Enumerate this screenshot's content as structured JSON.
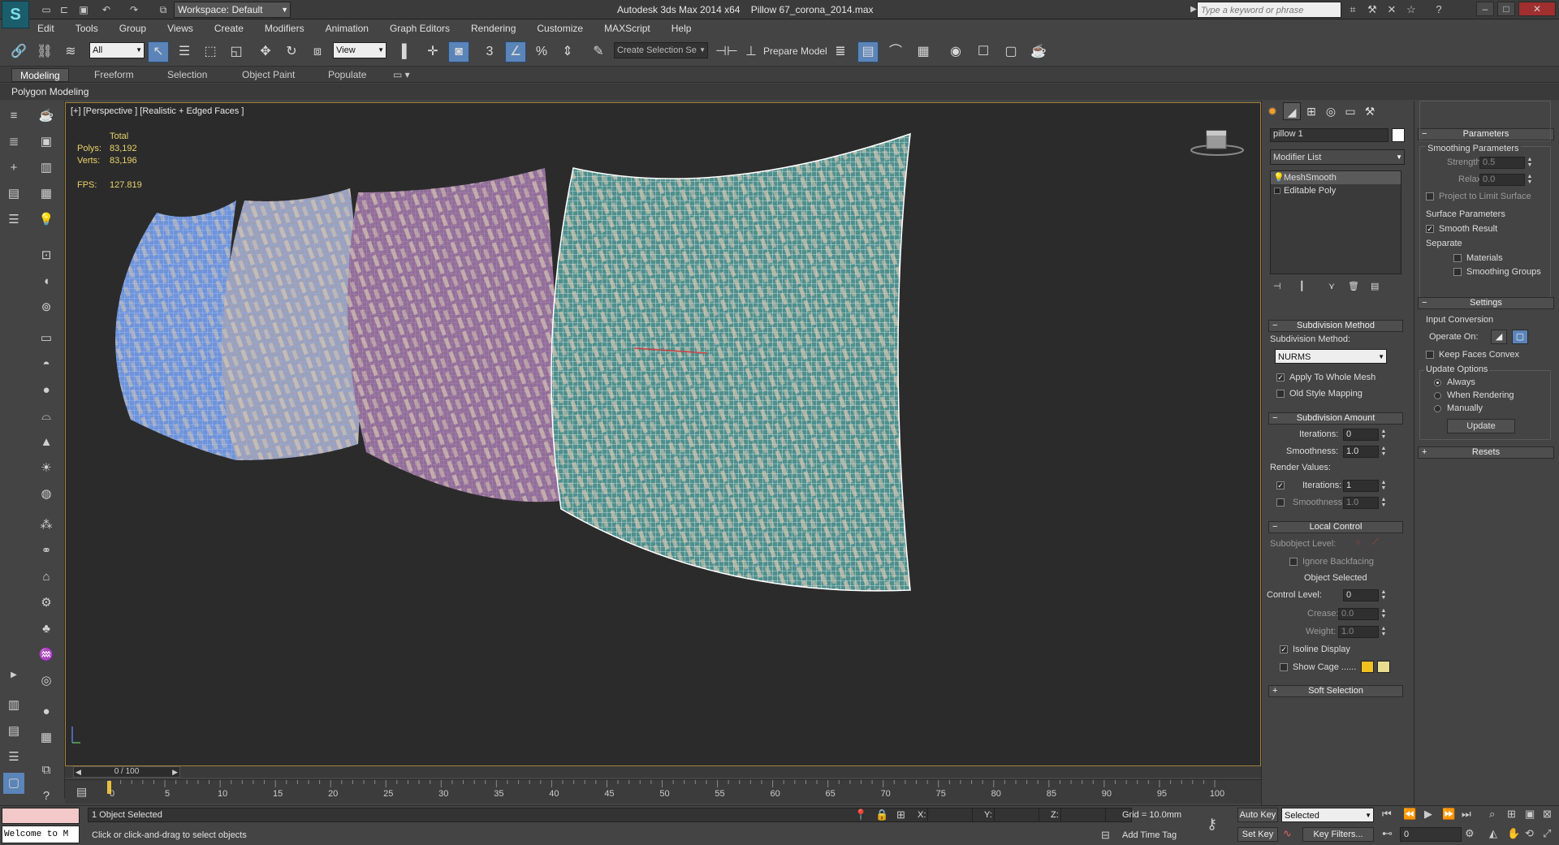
{
  "titlebar": {
    "workspace": "Workspace: Default",
    "app_title": "Autodesk 3ds Max  2014 x64",
    "file_name": "Pillow 67_corona_2014.max",
    "search_placeholder": "Type a keyword or phrase"
  },
  "menu": [
    "Edit",
    "Tools",
    "Group",
    "Views",
    "Create",
    "Modifiers",
    "Animation",
    "Graph Editors",
    "Rendering",
    "Customize",
    "MAXScript",
    "Help"
  ],
  "toolbar": {
    "selection_filter": "All",
    "ref_coord": "View",
    "snap_label": "3",
    "angle_snap_label": "%",
    "named_selection": "Create Selection Se",
    "prepare_model": "Prepare Model"
  },
  "ribbon": {
    "tabs": [
      "Modeling",
      "Freeform",
      "Selection",
      "Object Paint",
      "Populate"
    ],
    "active": "Modeling",
    "subpanel": "Polygon Modeling"
  },
  "viewport": {
    "label": "[+] [Perspective ] [Realistic + Edged Faces ]",
    "stats": {
      "total_label": "Total",
      "polys_label": "Polys:",
      "polys_value": "83,192",
      "verts_label": "Verts:",
      "verts_value": "83,196",
      "fps_label": "FPS:",
      "fps_value": "127.819"
    }
  },
  "timeline": {
    "frame_label": "0 / 100",
    "ticks": [
      "0",
      "5",
      "10",
      "15",
      "20",
      "25",
      "30",
      "35",
      "40",
      "45",
      "50",
      "55",
      "60",
      "65",
      "70",
      "75",
      "80",
      "85",
      "90",
      "95",
      "100"
    ]
  },
  "status": {
    "listener_text": "Welcome to M",
    "selected_text": "1 Object Selected",
    "prompt_text": "Click or click-and-drag to select objects",
    "x_label": "X:",
    "y_label": "Y:",
    "z_label": "Z:",
    "grid_text": "Grid = 10.0mm",
    "add_time_tag": "Add Time Tag",
    "auto_key": "Auto Key",
    "set_key": "Set Key",
    "key_mode": "Selected",
    "key_filters": "Key Filters...",
    "current_frame": "0"
  },
  "command_panel": {
    "object_name": "pillow 1",
    "object_color": "#ffffff",
    "modifier_list": "Modifier List",
    "stack": [
      "MeshSmooth",
      "Editable Poly"
    ],
    "subdivision_method": {
      "title": "Subdivision Method",
      "label": "Subdivision Method:",
      "value": "NURMS",
      "apply_whole_mesh": "Apply To Whole Mesh",
      "old_style_mapping": "Old Style Mapping"
    },
    "subdivision_amount": {
      "title": "Subdivision Amount",
      "iterations_label": "Iterations:",
      "iterations_value": "0",
      "smoothness_label": "Smoothness:",
      "smoothness_value": "1.0",
      "render_values": "Render Values:",
      "render_iterations_label": "Iterations:",
      "render_iterations_value": "1",
      "render_smoothness_label": "Smoothness:",
      "render_smoothness_value": "1.0"
    },
    "local_control": {
      "title": "Local Control",
      "subobject_level": "Subobject Level:",
      "ignore_backfacing": "Ignore Backfacing",
      "object_selected": "Object Selected",
      "control_level_label": "Control Level:",
      "control_level_value": "0",
      "crease_label": "Crease:",
      "crease_value": "0.0",
      "weight_label": "Weight:",
      "weight_value": "1.0",
      "isoline_display": "Isoline Display",
      "show_cage": "Show Cage ......",
      "cage_color_1": "#f0c020",
      "cage_color_2": "#e8dc90"
    },
    "soft_selection": "Soft Selection"
  },
  "parameters_panel": {
    "title": "Parameters",
    "smoothing_parameters": "Smoothing Parameters",
    "strength_label": "Strength:",
    "strength_value": "0.5",
    "relax_label": "Relax:",
    "relax_value": "0.0",
    "project_limit": "Project to Limit Surface",
    "surface_parameters": "Surface Parameters",
    "smooth_result": "Smooth Result",
    "separate": "Separate",
    "materials": "Materials",
    "smoothing_groups": "Smoothing Groups",
    "settings_title": "Settings",
    "input_conversion": "Input Conversion",
    "operate_on": "Operate On:",
    "keep_faces_convex": "Keep Faces Convex",
    "update_options": "Update Options",
    "always": "Always",
    "when_rendering": "When Rendering",
    "manually": "Manually",
    "update_button": "Update",
    "resets_title": "Resets"
  }
}
